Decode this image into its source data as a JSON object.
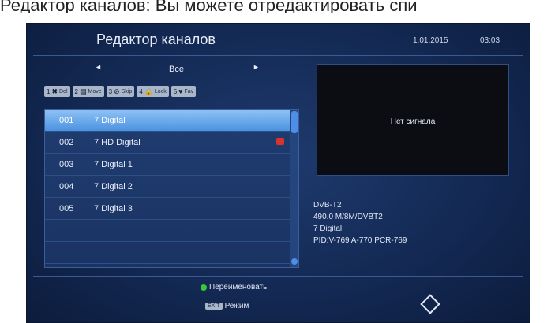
{
  "caption": "Редактор каналов: Вы можете отредактировать спи",
  "header": {
    "title": "Редактор каналов",
    "date": "1.01.2015",
    "time": "03:03"
  },
  "group": {
    "left_arrow": "◄",
    "right_arrow": "►",
    "name": "Все"
  },
  "fkeys": [
    {
      "num": "1",
      "icon": "✖",
      "label": "Del"
    },
    {
      "num": "2",
      "icon": "▤",
      "label": "Move"
    },
    {
      "num": "3",
      "icon": "⊘",
      "label": "Skip"
    },
    {
      "num": "4",
      "icon": "🔒",
      "label": "Lock"
    },
    {
      "num": "5",
      "icon": "♥",
      "label": "Fav"
    }
  ],
  "channels": [
    {
      "num": "001",
      "name": "7 Digital"
    },
    {
      "num": "002",
      "name": "7 HD Digital"
    },
    {
      "num": "003",
      "name": "7 Digital 1"
    },
    {
      "num": "004",
      "name": "7 Digital 2"
    },
    {
      "num": "005",
      "name": "7 Digital 3"
    }
  ],
  "preview": {
    "no_signal": "Нет сигнала"
  },
  "info": {
    "system": "DVB-T2",
    "freq": "490.0 M/8M/DVBT2",
    "channel": "7 Digital",
    "pids": "PID:V-769 A-770 PCR-769"
  },
  "footer": {
    "rename": "Переименовать",
    "mode_key": "EXIT",
    "mode_label": "Режим"
  },
  "colors": {
    "accent": "#4c93e0",
    "background": "#142a55",
    "green": "#38c93a",
    "lock_badge": "#d9332b"
  }
}
